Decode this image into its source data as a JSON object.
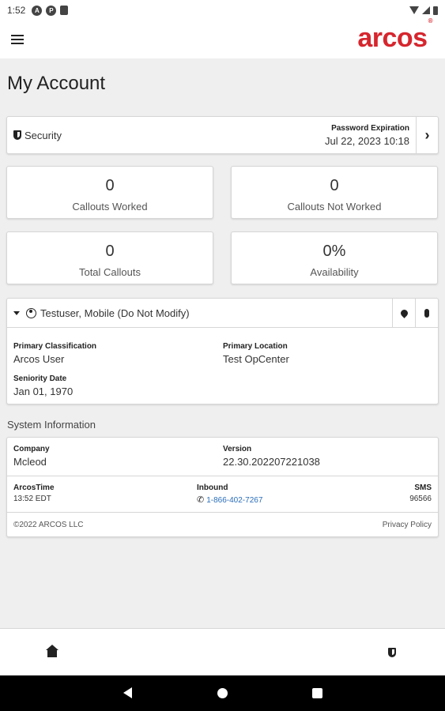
{
  "status_bar": {
    "time": "1:52",
    "icons": [
      "a-icon",
      "p-icon",
      "sim-icon",
      "wifi-icon",
      "signal-icon",
      "battery-icon"
    ]
  },
  "app_bar": {
    "logo_text": "arcos",
    "logo_mark": "®",
    "brand_color": "#d6262e"
  },
  "page": {
    "title": "My Account"
  },
  "security": {
    "label": "Security",
    "password_expiration_label": "Password Expiration",
    "password_expiration_value": "Jul 22, 2023 10:18"
  },
  "stats": [
    {
      "value": "0",
      "label": "Callouts Worked"
    },
    {
      "value": "0",
      "label": "Callouts Not Worked"
    },
    {
      "value": "0",
      "label": "Total Callouts"
    },
    {
      "value": "0%",
      "label": "Availability"
    }
  ],
  "user": {
    "name": "Testuser, Mobile (Do Not Modify)",
    "primary_classification_label": "Primary Classification",
    "primary_classification_value": "Arcos User",
    "primary_location_label": "Primary Location",
    "primary_location_value": "Test OpCenter",
    "seniority_date_label": "Seniority Date",
    "seniority_date_value": "Jan 01, 1970"
  },
  "system": {
    "section_title": "System Information",
    "company_label": "Company",
    "company_value": "Mcleod",
    "version_label": "Version",
    "version_value": "22.30.202207221038",
    "arcostime_label": "ArcosTime",
    "arcostime_value": "13:52 EDT",
    "inbound_label": "Inbound",
    "inbound_value": "1-866-402-7267",
    "sms_label": "SMS",
    "sms_value": "96566",
    "copyright": "©2022 ARCOS LLC",
    "privacy_policy": "Privacy Policy",
    "link_color": "#2a6ebb"
  },
  "bottom_nav": {
    "items": [
      "home-icon",
      "shield-icon"
    ]
  }
}
